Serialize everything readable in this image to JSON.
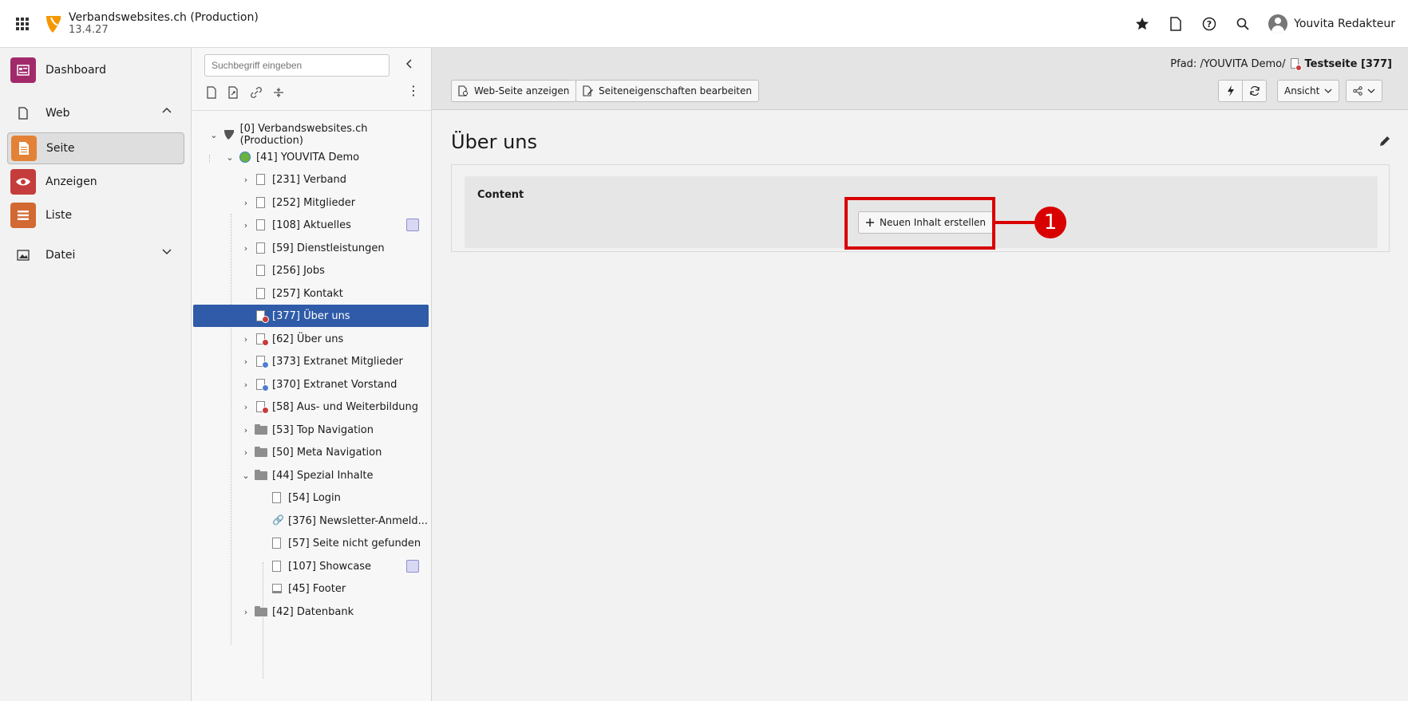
{
  "topbar": {
    "site_name": "Verbandswebsites.ch (Production)",
    "version": "13.4.27",
    "user_name": "Youvita Redakteur"
  },
  "modules": {
    "dashboard": "Dashboard",
    "web": "Web",
    "seite": "Seite",
    "anzeigen": "Anzeigen",
    "liste": "Liste",
    "datei": "Datei"
  },
  "module_colors": {
    "dashboard": "#a22a6a",
    "seite": "#e38236",
    "anzeigen": "#c43c3c",
    "liste": "#d26933"
  },
  "tree": {
    "search_placeholder": "Suchbegriff eingeben",
    "nodes": [
      {
        "label": "[0] Verbandswebsites.ch (Production)"
      },
      {
        "label": "[41] YOUVITA Demo"
      },
      {
        "label": "[231] Verband"
      },
      {
        "label": "[252] Mitglieder"
      },
      {
        "label": "[108] Aktuelles"
      },
      {
        "label": "[59] Dienstleistungen"
      },
      {
        "label": "[256] Jobs"
      },
      {
        "label": "[257] Kontakt"
      },
      {
        "label": "[377] Über uns"
      },
      {
        "label": "[62] Über uns"
      },
      {
        "label": "[373] Extranet Mitglieder"
      },
      {
        "label": "[370] Extranet Vorstand"
      },
      {
        "label": "[58] Aus- und Weiterbildung"
      },
      {
        "label": "[53] Top Navigation"
      },
      {
        "label": "[50] Meta Navigation"
      },
      {
        "label": "[44] Spezial Inhalte"
      },
      {
        "label": "[54] Login"
      },
      {
        "label": "[376] Newsletter-Anmeld..."
      },
      {
        "label": "[57] Seite nicht gefunden"
      },
      {
        "label": "[107] Showcase"
      },
      {
        "label": "[45] Footer"
      },
      {
        "label": "[42] Datenbank"
      }
    ]
  },
  "docheader": {
    "path_prefix": "Pfad: /YOUVITA Demo/",
    "path_page": "Testseite [377]",
    "view_page_btn": "Web-Seite anzeigen",
    "edit_props_btn": "Seiteneigenschaften bearbeiten",
    "view_dropdown": "Ansicht"
  },
  "main": {
    "page_title": "Über uns",
    "column_title": "Content",
    "new_content_btn": "Neuen Inhalt erstellen"
  },
  "annotation": {
    "number": "1",
    "color": "#d90000"
  },
  "colors": {
    "selected_tree": "#2f5ba8"
  }
}
